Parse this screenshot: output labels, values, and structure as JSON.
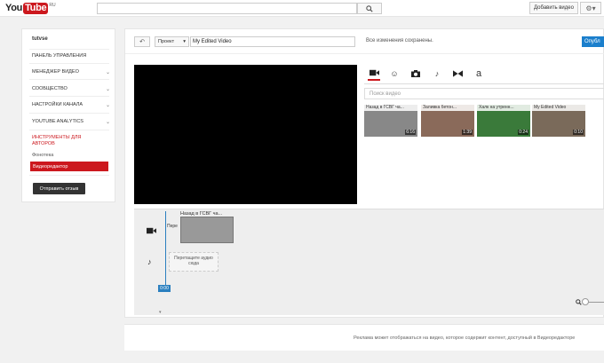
{
  "topbar": {
    "logo_you": "You",
    "logo_tube": "Tube",
    "logo_region": "RU",
    "search_placeholder": "",
    "upload_label": "Добавить видео",
    "settings_icon": "gear-icon"
  },
  "sidebar": {
    "username": "tutvse",
    "items": [
      {
        "label": "ПАНЕЛЬ УПРАВЛЕНИЯ",
        "has_chevron": false
      },
      {
        "label": "МЕНЕДЖЕР ВИДЕО",
        "has_chevron": true
      },
      {
        "label": "СООБЩЕСТВО",
        "has_chevron": true
      },
      {
        "label": "НАСТРОЙКИ КАНАЛА",
        "has_chevron": true
      },
      {
        "label": "YOUTUBE ANALYTICS",
        "has_chevron": true
      }
    ],
    "tools_label": "ИНСТРУМЕНТЫ ДЛЯ АВТОРОВ",
    "sub_items": [
      "Фонотека"
    ],
    "active_item": "Видеоредактор",
    "feedback_label": "Отправить отзыв",
    "chevron": "⌄"
  },
  "editor": {
    "undo_icon": "undo-icon",
    "project_label": "Проект",
    "title_value": "My Edited Video",
    "saved_status": "Все изменения сохранены.",
    "publish_label": "Опубл",
    "tabs": [
      {
        "icon": "video-camera-icon",
        "glyph": "■",
        "active": true
      },
      {
        "icon": "smiley-icon",
        "glyph": "☺",
        "active": false
      },
      {
        "icon": "photo-camera-icon",
        "glyph": "◘",
        "active": false
      },
      {
        "icon": "music-note-icon",
        "glyph": "♪",
        "active": false
      },
      {
        "icon": "transition-icon",
        "glyph": "⋈",
        "active": false
      },
      {
        "icon": "text-icon",
        "glyph": "a",
        "active": false
      }
    ],
    "media_search_placeholder": "Поиск видео",
    "thumbnails": [
      {
        "title": "Назад в ГСВГ ча...",
        "duration": "6:16",
        "color": "#9a9a9a"
      },
      {
        "title": "Заливка бетон...",
        "duration": "1:39",
        "color": "#8a6a5a"
      },
      {
        "title": "Халк на утренн...",
        "duration": "0:24",
        "color": "#3a7a3a"
      },
      {
        "title": "My Edited Video",
        "duration": "0:10",
        "color": "#7a6a5a"
      }
    ]
  },
  "timeline": {
    "video_track_icon": "video-camera-icon",
    "audio_track_icon": "music-note-icon",
    "clip_title": "Назад в ГСВГ ча...",
    "clip_left_label": "Пере",
    "audio_drop_text": "Перетащите аудио сюда",
    "playhead_time": "0:00",
    "zoom_icon": "zoom-icon",
    "zoom_level": 0
  },
  "footer": {
    "text": "Реклама может отображаться на видео, которое содержит контент, доступный в Видеоредакторе"
  }
}
